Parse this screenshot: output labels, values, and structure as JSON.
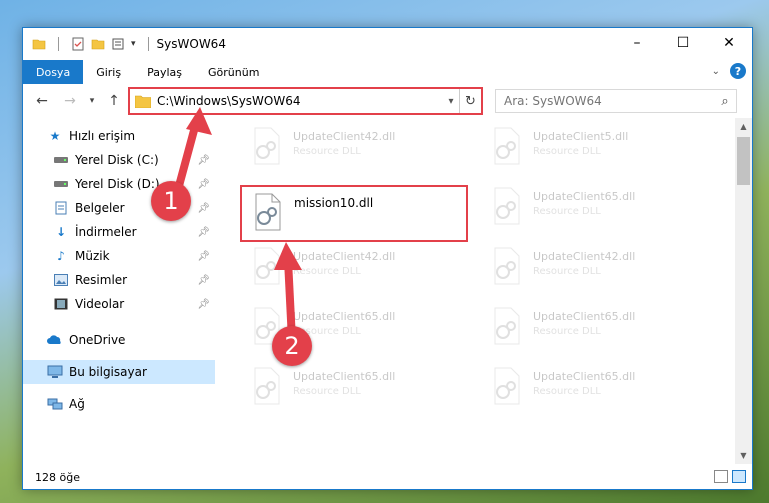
{
  "window": {
    "title": "SysWOW64",
    "controls": {
      "minimize": "–",
      "maximize": "☐",
      "close": "✕"
    }
  },
  "ribbon": {
    "tabs": [
      {
        "label": "Dosya",
        "active": true
      },
      {
        "label": "Giriş"
      },
      {
        "label": "Paylaş"
      },
      {
        "label": "Görünüm"
      }
    ],
    "help": "?"
  },
  "navigation": {
    "address": "C:\\Windows\\SysWOW64",
    "search_placeholder": "Ara: SysWOW64"
  },
  "sidebar": {
    "items": [
      {
        "label": "Hızlı erişim",
        "icon": "star-icon"
      },
      {
        "label": "Yerel Disk (C:)",
        "icon": "drive-icon",
        "pinned": true
      },
      {
        "label": "Yerel Disk (D:)",
        "icon": "drive-icon",
        "pinned": true
      },
      {
        "label": "Belgeler",
        "icon": "documents-icon",
        "pinned": true
      },
      {
        "label": "İndirmeler",
        "icon": "download-icon",
        "pinned": true
      },
      {
        "label": "Müzik",
        "icon": "music-icon",
        "pinned": true
      },
      {
        "label": "Resimler",
        "icon": "pictures-icon",
        "pinned": true
      },
      {
        "label": "Videolar",
        "icon": "videos-icon",
        "pinned": true
      },
      {
        "label": "OneDrive",
        "icon": "cloud-icon"
      },
      {
        "label": "Bu bilgisayar",
        "icon": "computer-icon",
        "selected": true
      },
      {
        "label": "Ağ",
        "icon": "network-icon"
      }
    ]
  },
  "files": [
    {
      "name": "UpdateClient42.dll",
      "type": "Resource DLL"
    },
    {
      "name": "UpdateClient5.dll",
      "type": "Resource DLL"
    },
    {
      "name": "mission10.dll",
      "type": ""
    },
    {
      "name": "UpdateClient65.dll",
      "type": "Resource DLL"
    },
    {
      "name": "UpdateClient42.dll",
      "type": "Resource DLL"
    },
    {
      "name": "UpdateClient42.dll",
      "type": "Resource DLL"
    },
    {
      "name": "UpdateClient65.dll",
      "type": "Resource DLL"
    },
    {
      "name": "UpdateClient65.dll",
      "type": "Resource DLL"
    },
    {
      "name": "UpdateClient65.dll",
      "type": "Resource DLL"
    },
    {
      "name": "UpdateClient65.dll",
      "type": "Resource DLL"
    }
  ],
  "status": {
    "item_count": "128 öğe"
  },
  "annotations": {
    "step1": "1",
    "step2": "2",
    "color": "#e3404a"
  },
  "colors": {
    "accent": "#1979ca",
    "selection": "#cce8ff"
  }
}
